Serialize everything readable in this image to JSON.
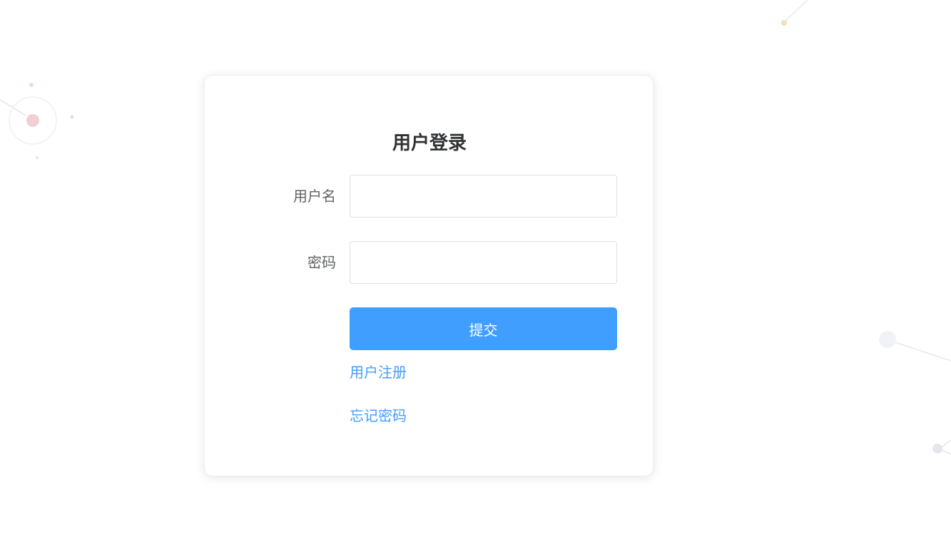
{
  "login": {
    "title": "用户登录",
    "username_label": "用户名",
    "username_value": "",
    "password_label": "密码",
    "password_value": "",
    "submit_label": "提交",
    "register_link": "用户注册",
    "forgot_link": "忘记密码"
  },
  "colors": {
    "primary": "#409eff",
    "title_text": "#303133",
    "label_text": "#606266",
    "input_border": "#dcdfe6",
    "background": "#ffffff"
  }
}
